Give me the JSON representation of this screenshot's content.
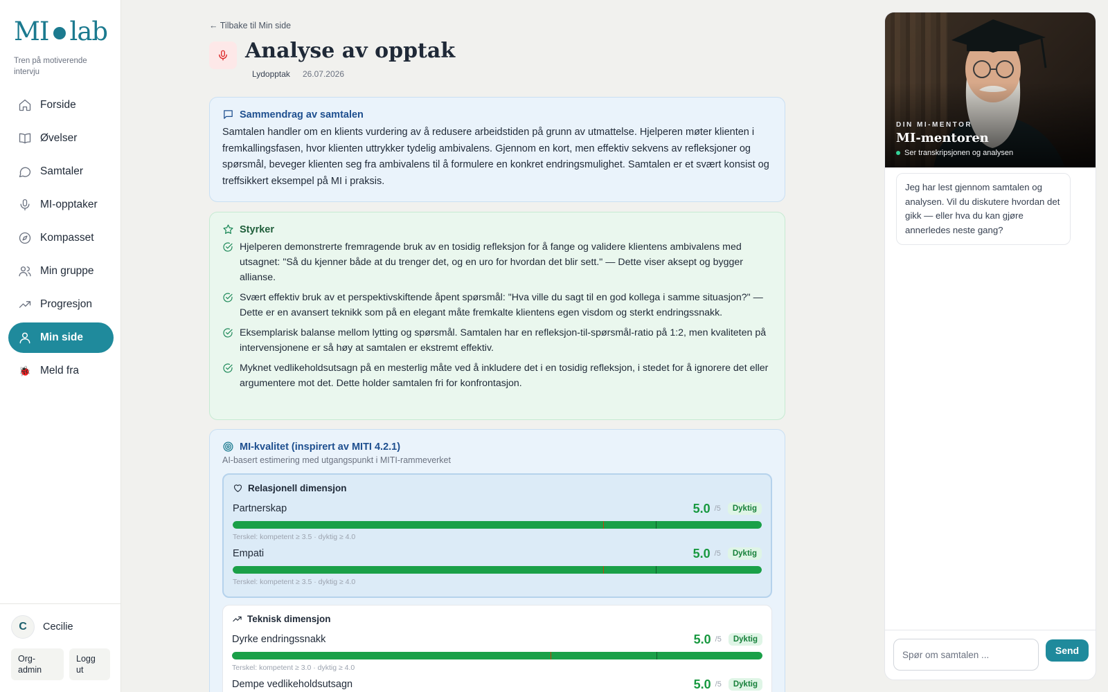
{
  "sidebar": {
    "logo_left": "MI",
    "logo_right": "lab",
    "tagline": "Tren på motiverende intervju",
    "items": [
      {
        "label": "Forside",
        "icon": "home-icon"
      },
      {
        "label": "Øvelser",
        "icon": "book-icon"
      },
      {
        "label": "Samtaler",
        "icon": "chat-icon"
      },
      {
        "label": "MI-opptaker",
        "icon": "microphone-icon"
      },
      {
        "label": "Kompasset",
        "icon": "compass-icon"
      },
      {
        "label": "Min gruppe",
        "icon": "users-icon"
      },
      {
        "label": "Progresjon",
        "icon": "trending-up-icon"
      },
      {
        "label": "Min side",
        "icon": "user-icon",
        "active": true
      },
      {
        "label": "Meld fra",
        "icon": "ladybug-icon"
      }
    ],
    "user": {
      "initial": "C",
      "name": "Cecilie"
    },
    "org_admin_label": "Org-admin",
    "logout_label": "Logg ut"
  },
  "header": {
    "back_label": "← Tilbake til Min side",
    "title": "Analyse av opptak",
    "type": "Lydopptak",
    "date": "26.07.2026"
  },
  "summary": {
    "heading": "Sammendrag av samtalen",
    "text": "Samtalen handler om en klients vurdering av å redusere arbeidstiden på grunn av utmattelse. Hjelperen møter klienten i fremkallingsfasen, hvor klienten uttrykker tydelig ambivalens. Gjennom en kort, men effektiv sekvens av refleksjoner og spørsmål, beveger klienten seg fra ambivalens til å formulere en konkret endringsmulighet. Samtalen er et svært konsist og treffsikkert eksempel på MI i praksis."
  },
  "strengths": {
    "heading": "Styrker",
    "items": [
      "Hjelperen demonstrerte fremragende bruk av en tosidig refleksjon for å fange og validere klientens ambivalens med utsagnet: \"Så du kjenner både at du trenger det, og en uro for hvordan det blir sett.\" — Dette viser aksept og bygger allianse.",
      "Svært effektiv bruk av et perspektivskiftende åpent spørsmål: \"Hva ville du sagt til en god kollega i samme situasjon?\" — Dette er en avansert teknikk som på en elegant måte fremkalte klientens egen visdom og sterkt endringssnakk.",
      "Eksemplarisk balanse mellom lytting og spørsmål. Samtalen har en refleksjon-til-spørsmål-ratio på 1:2, men kvaliteten på intervensjonene er så høy at samtalen er ekstremt effektiv.",
      "Myknet vedlikeholdsutsagn på en mesterlig måte ved å inkludere det i en tosidig refleksjon, i stedet for å ignorere det eller argumentere mot det. Dette holder samtalen fri for konfrontasjon."
    ]
  },
  "quality": {
    "heading": "MI-kvalitet (inspirert av MITI 4.2.1)",
    "subtitle": "AI-basert estimering med utgangspunkt i MITI-rammeverket",
    "relational": {
      "heading": "Relasjonell dimensjon",
      "metrics": [
        {
          "name": "Partnerskap",
          "score": "5.0",
          "out_of": "/5",
          "badge": "Dyktig",
          "threshold": "Terskel: kompetent ≥ 3.5 · dyktig ≥ 4.0"
        },
        {
          "name": "Empati",
          "score": "5.0",
          "out_of": "/5",
          "badge": "Dyktig",
          "threshold": "Terskel: kompetent ≥ 3.5 · dyktig ≥ 4.0"
        }
      ]
    },
    "technical": {
      "heading": "Teknisk dimensjon",
      "metrics": [
        {
          "name": "Dyrke endringssnakk",
          "score": "5.0",
          "out_of": "/5",
          "badge": "Dyktig",
          "threshold": "Terskel: kompetent ≥ 3.0 · dyktig ≥ 4.0"
        },
        {
          "name": "Dempe vedlikeholdsutsagn",
          "score": "5.0",
          "out_of": "/5",
          "badge": "Dyktig",
          "threshold": ""
        }
      ]
    }
  },
  "mentor": {
    "label": "DIN MI-MENTOR",
    "name": "MI-mentoren",
    "status": "Ser transkripsjonen og analysen",
    "message": "Jeg har lest gjennom samtalen og analysen. Vil du diskutere hvordan det gikk — eller hva du kan gjøre annerledes neste gang?",
    "input_placeholder": "Spør om samtalen ...",
    "send_label": "Send"
  },
  "colors": {
    "accent": "#1f8a9c",
    "score_green": "#17983f"
  }
}
